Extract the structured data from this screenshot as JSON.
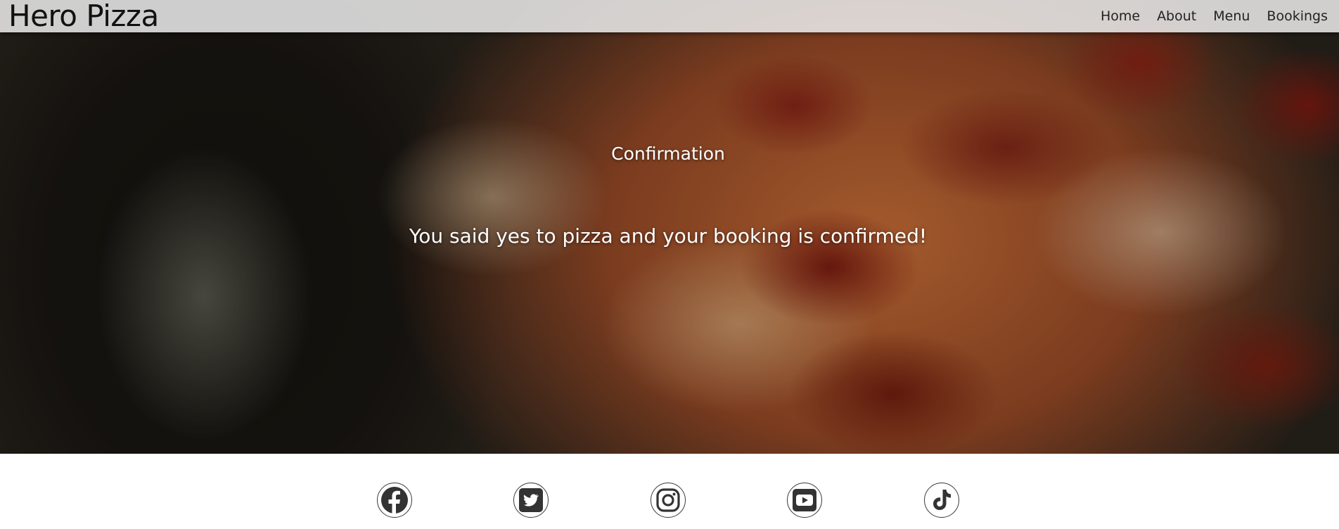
{
  "header": {
    "logo": "Hero Pizza",
    "nav": [
      {
        "label": "Home"
      },
      {
        "label": "About"
      },
      {
        "label": "Menu"
      },
      {
        "label": "Bookings"
      }
    ]
  },
  "hero": {
    "title": "Confirmation",
    "message": "You said yes to pizza and your booking is confirmed!"
  },
  "footer": {
    "social_icons": [
      "facebook-icon",
      "twitter-icon",
      "instagram-icon",
      "youtube-icon",
      "tiktok-icon"
    ]
  },
  "colors": {
    "header_bg": "#e8e8e8",
    "text_dark": "#111111",
    "hero_text": "#ffffff",
    "icon": "#333333"
  }
}
